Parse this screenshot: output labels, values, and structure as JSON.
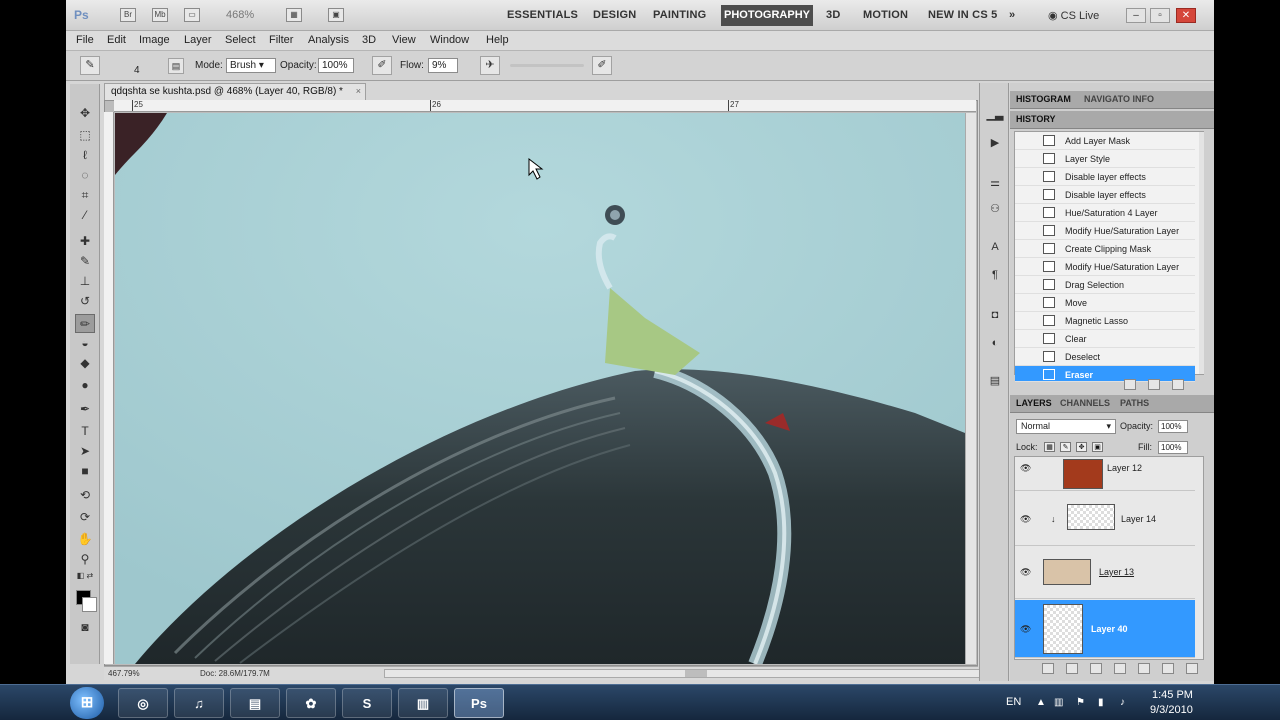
{
  "appbar": {
    "logo": "Ps",
    "icons": [
      "Br",
      "Mb"
    ],
    "zoom": "468%",
    "workspaces": [
      "ESSENTIALS",
      "DESIGN",
      "PAINTING",
      "PHOTOGRAPHY",
      "3D",
      "MOTION",
      "NEW IN CS 5"
    ],
    "active_workspace": "PHOTOGRAPHY",
    "more": "»",
    "cs_live": "CS Live"
  },
  "menu": [
    "File",
    "Edit",
    "Image",
    "Layer",
    "Select",
    "Filter",
    "Analysis",
    "3D",
    "View",
    "Window",
    "Help"
  ],
  "options": {
    "brush_size": "4",
    "mode_label": "Mode:",
    "mode_value": "Brush",
    "opacity_label": "Opacity:",
    "opacity_value": "100%",
    "flow_label": "Flow:",
    "flow_value": "9%"
  },
  "document": {
    "tab_title": "qdqshta se kushta.psd @ 468% (Layer 40, RGB/8) *",
    "close_glyph": "×",
    "ruler_labels": [
      "25",
      "26",
      "27"
    ],
    "status_zoom": "467.79%",
    "status_doc": "Doc: 28.6M/179.7M"
  },
  "panels": {
    "top_tabs": [
      "HISTOGRAM",
      "NAVIGATO INFO"
    ],
    "history_tab": "HISTORY",
    "history_items": [
      "Add Layer Mask",
      "Layer Style",
      "Disable layer effects",
      "Disable layer effects",
      "Hue/Saturation 4 Layer",
      "Modify Hue/Saturation Layer",
      "Create Clipping Mask",
      "Modify Hue/Saturation Layer",
      "Drag Selection",
      "Move",
      "Magnetic Lasso",
      "Clear",
      "Deselect",
      "Eraser"
    ],
    "history_selected": "Eraser",
    "layer_tabs": [
      "LAYERS",
      "CHANNELS",
      "PATHS"
    ],
    "blend_mode": "Normal",
    "opacity_label": "Opacity:",
    "opacity_value": "100%",
    "lock_label": "Lock:",
    "fill_label": "Fill:",
    "fill_value": "100%",
    "layers": [
      {
        "name": "Layer 12",
        "selected": false
      },
      {
        "name": "Layer 14",
        "selected": false
      },
      {
        "name": "Layer 13",
        "selected": false
      },
      {
        "name": "Layer 40",
        "selected": true
      }
    ]
  },
  "taskbar": {
    "lang": "EN",
    "time": "1:45 PM",
    "date": "9/3/2010",
    "apps": [
      "chrome-icon",
      "itunes-icon",
      "explorer-icon",
      "picasa-icon",
      "skype-icon",
      "notes-icon",
      "photoshop-icon"
    ],
    "skype_label": "S",
    "photoshop_label": "Ps"
  }
}
